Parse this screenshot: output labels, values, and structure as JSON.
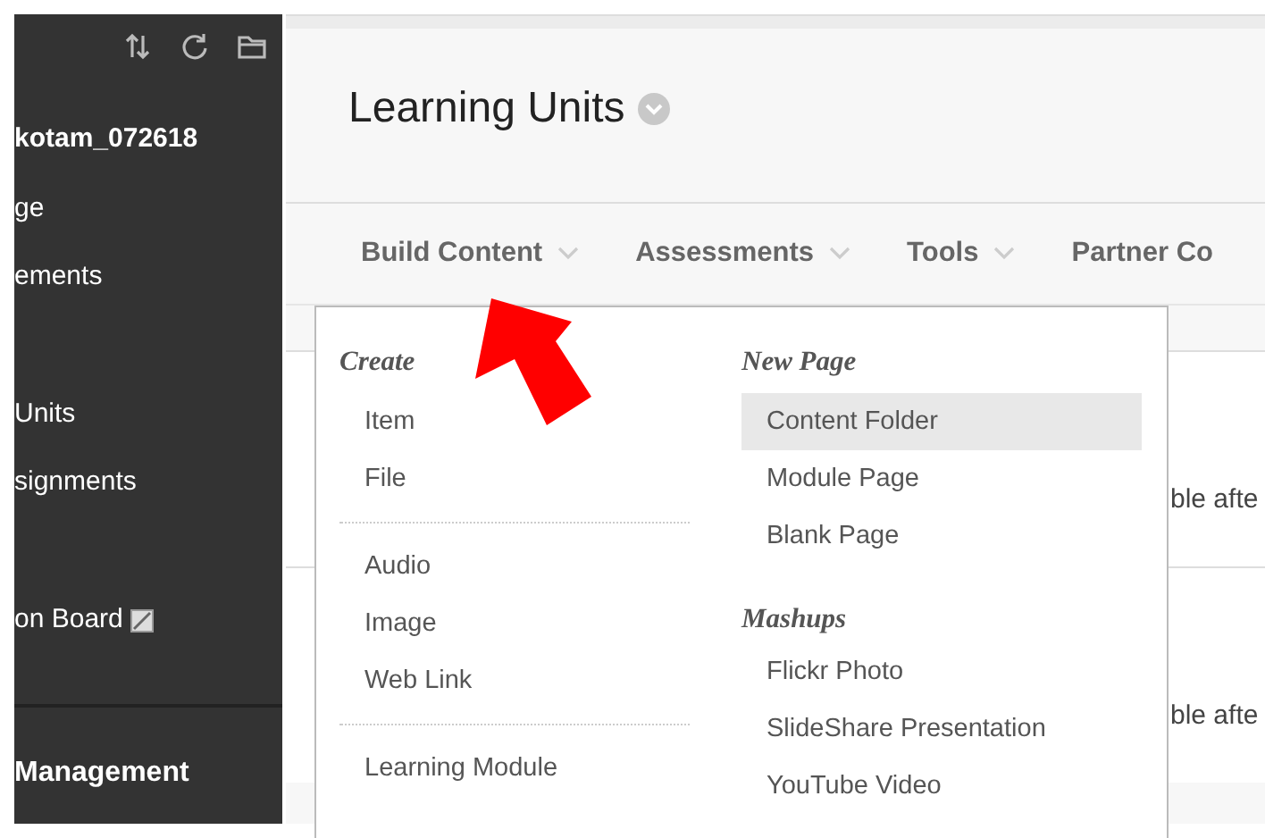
{
  "sidebar": {
    "user": "kotam_072618",
    "groups": [
      [
        {
          "label": "ge",
          "hidden": false
        },
        {
          "label": "ements",
          "hidden": false
        }
      ],
      [
        {
          "label": "Units",
          "hidden": false
        },
        {
          "label": "signments",
          "hidden": false
        }
      ],
      [
        {
          "label": "on Board",
          "hidden": true
        }
      ]
    ],
    "section": "Management"
  },
  "header": {
    "title": "Learning Units"
  },
  "nav": [
    {
      "label": "Build Content",
      "caret": true
    },
    {
      "label": "Assessments",
      "caret": true
    },
    {
      "label": "Tools",
      "caret": true
    },
    {
      "label": "Partner Co",
      "caret": false
    }
  ],
  "menu": {
    "columns": [
      {
        "sections": [
          {
            "heading": "Create",
            "groups": [
              [
                {
                  "label": "Item",
                  "selected": false
                },
                {
                  "label": "File",
                  "selected": false
                }
              ],
              [
                {
                  "label": "Audio",
                  "selected": false
                },
                {
                  "label": "Image",
                  "selected": false
                },
                {
                  "label": "Web Link",
                  "selected": false
                }
              ],
              [
                {
                  "label": "Learning Module",
                  "selected": false
                }
              ]
            ]
          }
        ]
      },
      {
        "sections": [
          {
            "heading": "New Page",
            "groups": [
              [
                {
                  "label": "Content Folder",
                  "selected": true
                },
                {
                  "label": "Module Page",
                  "selected": false
                },
                {
                  "label": "Blank Page",
                  "selected": false
                }
              ]
            ]
          },
          {
            "heading": "Mashups",
            "groups": [
              [
                {
                  "label": "Flickr Photo",
                  "selected": false
                },
                {
                  "label": "SlideShare Presentation",
                  "selected": false
                },
                {
                  "label": "YouTube Video",
                  "selected": false
                }
              ]
            ]
          }
        ]
      }
    ]
  },
  "content_rows": [
    {
      "text": "ble afte"
    },
    {
      "text": "ble afte"
    }
  ]
}
